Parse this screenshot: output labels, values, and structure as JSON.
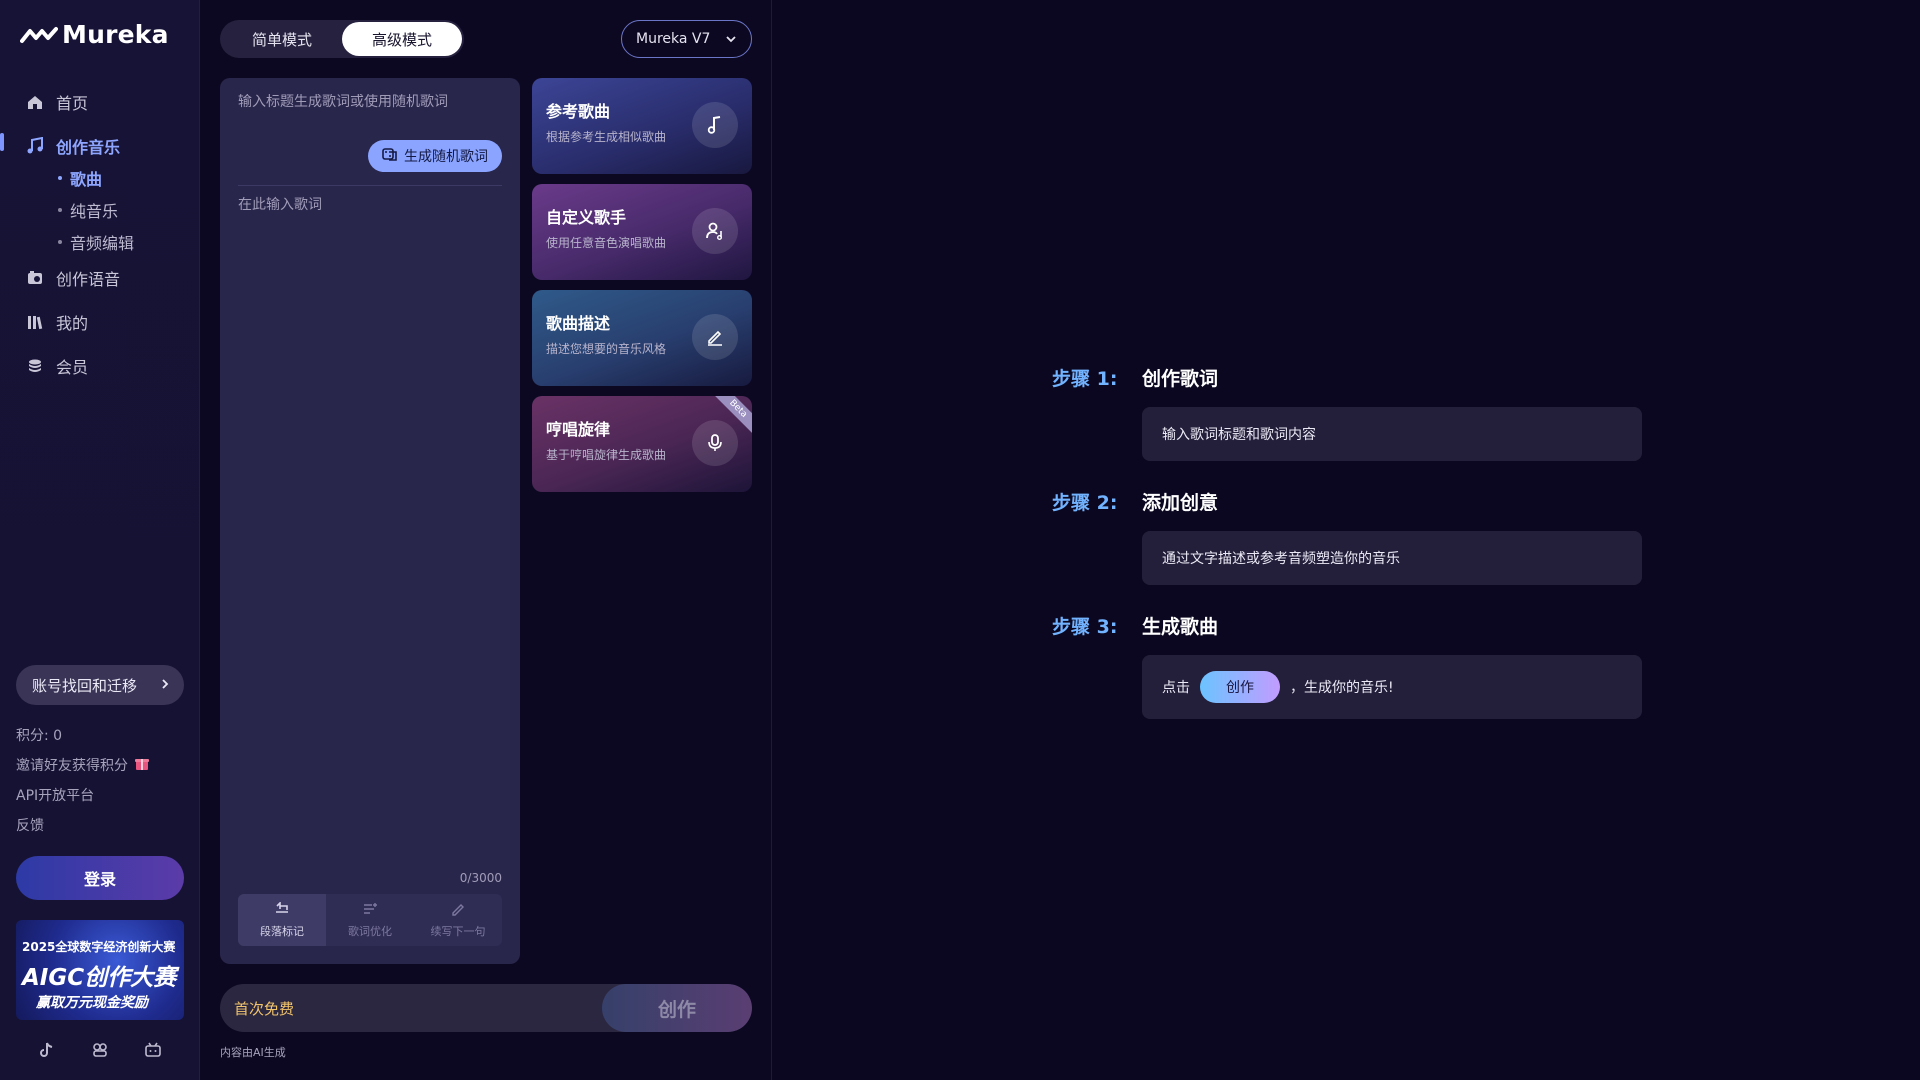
{
  "sidebar": {
    "logo_text": "Mureka",
    "nav": [
      {
        "label": "首页",
        "icon": "home-icon"
      },
      {
        "label": "创作音乐",
        "icon": "music-note-icon"
      },
      {
        "label": "创作语音",
        "icon": "voice-icon"
      },
      {
        "label": "我的",
        "icon": "library-icon"
      },
      {
        "label": "会员",
        "icon": "coins-icon"
      }
    ],
    "sub_nav": [
      {
        "label": "歌曲"
      },
      {
        "label": "纯音乐"
      },
      {
        "label": "音频编辑"
      }
    ],
    "recover_label": "账号找回和迁移",
    "points_label": "积分: 0",
    "invite_label": "邀请好友获得积分",
    "api_label": "API开放平台",
    "feedback_label": "反馈",
    "login_label": "登录",
    "banner": {
      "line1": "2025全球数字经济创新大赛",
      "line2": "AIGC创作大赛",
      "line3": "赢取万元现金奖励"
    },
    "social_icons": [
      "tiktok-icon",
      "discord-icon",
      "bilibili-icon"
    ]
  },
  "middle": {
    "modes": {
      "simple": "简单模式",
      "advanced": "高级模式"
    },
    "active_mode": "advanced",
    "model": "Mureka V7",
    "title_placeholder": "输入标题生成歌词或使用随机歌词",
    "random_lyrics_label": "生成随机歌词",
    "lyrics_placeholder": "在此输入歌词",
    "char_count": "0/3000",
    "tools": [
      {
        "label": "段落标记",
        "icon": "paragraph-icon"
      },
      {
        "label": "歌词优化",
        "icon": "optimize-icon"
      },
      {
        "label": "续写下一句",
        "icon": "pen-icon"
      }
    ],
    "cards": [
      {
        "title": "参考歌曲",
        "desc": "根据参考生成相似歌曲",
        "icon": "music-note-icon"
      },
      {
        "title": "自定义歌手",
        "desc": "使用任意音色演唱歌曲",
        "icon": "singer-icon"
      },
      {
        "title": "歌曲描述",
        "desc": "描述您想要的音乐风格",
        "icon": "edit-icon"
      },
      {
        "title": "哼唱旋律",
        "desc": "基于哼唱旋律生成歌曲",
        "icon": "microphone-icon",
        "badge": "Beta"
      }
    ],
    "free_label": "首次免费",
    "create_label": "创作",
    "ai_note": "内容由AI生成"
  },
  "steps": [
    {
      "label": "步骤 1:",
      "title": "创作歌词",
      "text": "输入歌词标题和歌词内容"
    },
    {
      "label": "步骤 2:",
      "title": "添加创意",
      "text": "通过文字描述或参考音频塑造你的音乐"
    },
    {
      "label": "步骤 3:",
      "title": "生成歌曲",
      "prefix": "点击",
      "pill": "创作",
      "suffix": "，生成你的音乐!"
    }
  ],
  "colors": {
    "accent": "#8ea6ff",
    "step_label": "#72b3ff",
    "free_text": "#f2c46b"
  }
}
